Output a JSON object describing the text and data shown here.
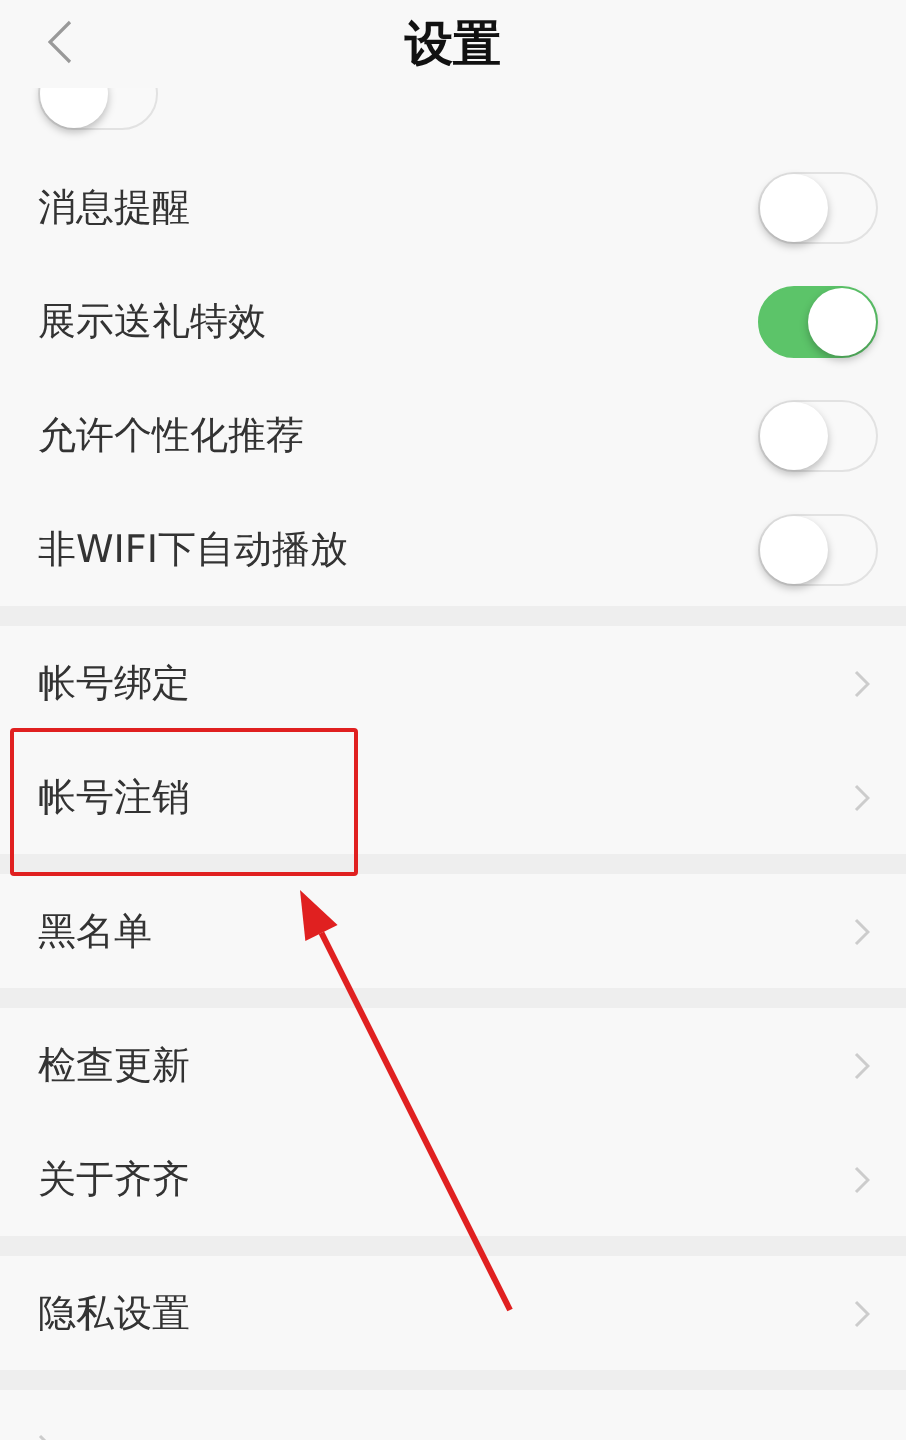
{
  "header": {
    "title": "设置"
  },
  "sections": [
    {
      "rows": [
        {
          "kind": "toggle",
          "partial": true,
          "on": false
        },
        {
          "kind": "toggle",
          "label": "消息提醒",
          "on": false
        },
        {
          "kind": "toggle",
          "label": "展示送礼特效",
          "on": true
        },
        {
          "kind": "toggle",
          "label": "允许个性化推荐",
          "on": false
        },
        {
          "kind": "toggle",
          "label": "非WIFI下自动播放",
          "on": false
        }
      ]
    },
    {
      "rows": [
        {
          "kind": "link",
          "label": "帐号绑定",
          "highlighted": false
        },
        {
          "kind": "link",
          "label": "帐号注销",
          "highlighted": true
        }
      ]
    },
    {
      "rows": [
        {
          "kind": "link",
          "label": "黑名单",
          "highlighted": false
        }
      ]
    },
    {
      "rows": [
        {
          "kind": "link",
          "label": "检查更新",
          "highlighted": false
        },
        {
          "kind": "link",
          "label": "关于齐齐",
          "highlighted": false
        }
      ]
    },
    {
      "rows": [
        {
          "kind": "link",
          "label": "隐私设置",
          "highlighted": false
        }
      ]
    },
    {
      "rows": [
        {
          "kind": "link",
          "highlighted": false
        }
      ]
    }
  ]
}
